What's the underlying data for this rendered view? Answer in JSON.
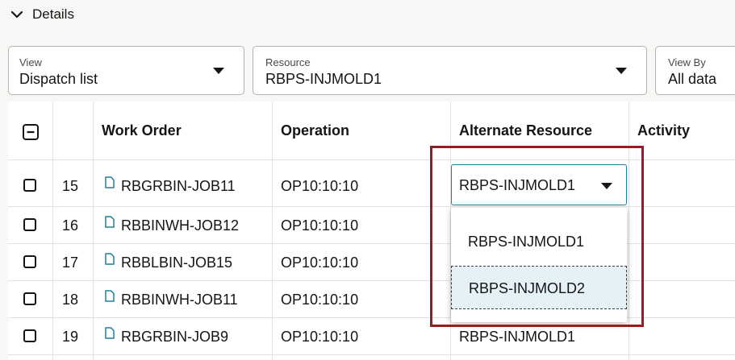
{
  "section": {
    "title": "Details"
  },
  "filters": {
    "view": {
      "label": "View",
      "value": "Dispatch list"
    },
    "resource": {
      "label": "Resource",
      "value": "RBPS-INJMOLD1"
    },
    "view_by": {
      "label": "View By",
      "value": "All data"
    }
  },
  "table": {
    "columns": [
      "Work Order",
      "Operation",
      "Alternate Resource",
      "Activity"
    ],
    "rows": [
      {
        "num": "15",
        "work_order": "RBGRBIN-JOB11",
        "operation": "OP10:10:10",
        "alternate_resource": "RBPS-INJMOLD1"
      },
      {
        "num": "16",
        "work_order": "RBBINWH-JOB12",
        "operation": "OP10:10:10",
        "alternate_resource": ""
      },
      {
        "num": "17",
        "work_order": "RBBLBIN-JOB15",
        "operation": "OP10:10:10",
        "alternate_resource": ""
      },
      {
        "num": "18",
        "work_order": "RBBINWH-JOB11",
        "operation": "OP10:10:10",
        "alternate_resource": ""
      },
      {
        "num": "19",
        "work_order": "RBGRBIN-JOB9",
        "operation": "OP10:10:10",
        "alternate_resource": "RBPS-INJMOLD1"
      }
    ]
  },
  "dropdown": {
    "options": [
      "RBPS-INJMOLD1",
      "RBPS-INJMOLD2"
    ],
    "selected_index": 1
  },
  "colors": {
    "highlight": "#9b1c1c",
    "focus": "#227e9e",
    "option_selected_bg": "#e4f1f7"
  },
  "icons": {
    "section_toggle": "chevron-down-icon",
    "row_link": "document-icon",
    "select_all": "minus-checkbox-icon"
  }
}
